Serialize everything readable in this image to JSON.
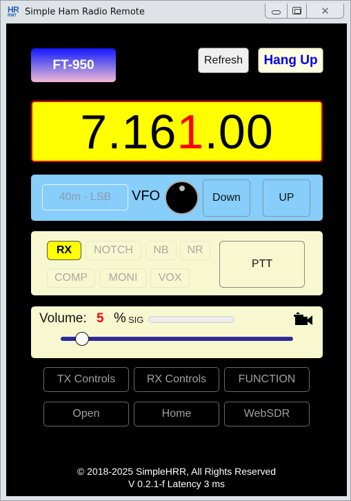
{
  "window": {
    "title": "Simple Ham Radio Remote",
    "app_icon": {
      "top": "HR",
      "bottom": "RMT",
      "color": "#1b5fb8"
    },
    "controls": {
      "minimize": "minimize-icon",
      "maximize": "restore-icon",
      "close": "close-icon",
      "close_glyph": "✕"
    }
  },
  "header": {
    "rig_label": "FT-950",
    "refresh_label": "Refresh",
    "hangup_label": "Hang Up"
  },
  "frequency": {
    "prefix": "7.16",
    "highlight": "1",
    "suffix": ".00",
    "highlight_color": "#ff0000",
    "background": "#ffff00"
  },
  "vfo": {
    "band_mode": "40m - LSB",
    "label": "VFO",
    "down_label": "Down",
    "up_label": "UP"
  },
  "functions": {
    "buttons": [
      {
        "label": "RX",
        "active": true
      },
      {
        "label": "NOTCH",
        "active": false
      },
      {
        "label": "NB",
        "active": false
      },
      {
        "label": "NR",
        "active": false
      },
      {
        "label": "COMP",
        "active": false
      },
      {
        "label": "MONI",
        "active": false
      },
      {
        "label": "VOX",
        "active": false
      }
    ],
    "ptt_label": "PTT"
  },
  "volume": {
    "label": "Volume:",
    "value": "5",
    "value_percent": 5,
    "unit": "%",
    "sig_label": "SIG",
    "sig_level": 0,
    "camera_icon": "video-camera-icon"
  },
  "nav": {
    "row1": [
      "TX Controls",
      "RX Controls",
      "FUNCTION"
    ],
    "row2": [
      "Open",
      "Home",
      "WebSDR"
    ]
  },
  "footer": {
    "copyright": "© 2018-2025 SimpleHRR,  All Rights Reserved",
    "version_line": "V 0.2.1-f  Latency   3   ms"
  }
}
